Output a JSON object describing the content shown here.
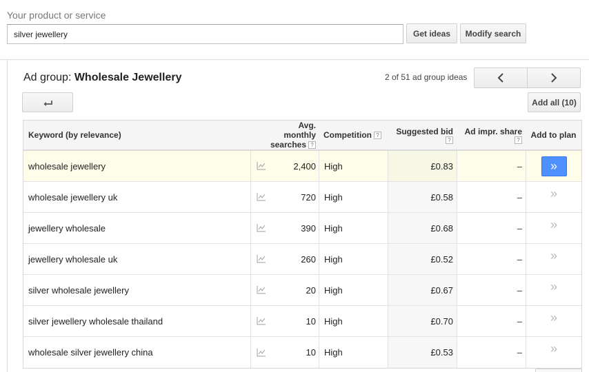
{
  "search": {
    "label": "Your product or service",
    "value": "silver jewellery",
    "get_ideas": "Get ideas",
    "modify_search": "Modify search"
  },
  "adgroup": {
    "prefix": "Ad group: ",
    "name": "Wholesale Jewellery",
    "pager_text": "2 of 51 ad group ideas",
    "add_all": "Add all (10)"
  },
  "table": {
    "headers": {
      "keyword": "Keyword (by relevance)",
      "avg_line1": "Avg. monthly",
      "avg_line2": "searches",
      "competition": "Competition",
      "bid_line1": "Suggested bid",
      "impr": "Ad impr. share",
      "add": "Add to plan",
      "help": "?"
    },
    "rows": [
      {
        "keyword": "wholesale jewellery",
        "searches": "2,400",
        "competition": "High",
        "bid": "£0.83",
        "impr": "–"
      },
      {
        "keyword": "wholesale jewellery uk",
        "searches": "720",
        "competition": "High",
        "bid": "£0.58",
        "impr": "–"
      },
      {
        "keyword": "jewellery wholesale",
        "searches": "390",
        "competition": "High",
        "bid": "£0.68",
        "impr": "–"
      },
      {
        "keyword": "jewellery wholesale uk",
        "searches": "260",
        "competition": "High",
        "bid": "£0.52",
        "impr": "–"
      },
      {
        "keyword": "silver wholesale jewellery",
        "searches": "20",
        "competition": "High",
        "bid": "£0.67",
        "impr": "–"
      },
      {
        "keyword": "silver jewellery wholesale thailand",
        "searches": "10",
        "competition": "High",
        "bid": "£0.70",
        "impr": "–"
      },
      {
        "keyword": "wholesale silver jewellery china",
        "searches": "10",
        "competition": "High",
        "bid": "£0.53",
        "impr": "–"
      }
    ]
  },
  "icons": {
    "add": "»",
    "trend": "trend-chart-icon",
    "back": "back-arrow-icon",
    "prev": "chevron-left-icon",
    "next": "chevron-right-icon"
  },
  "colors": {
    "accent": "#4d90fe",
    "highlight_row": "#fdfde9"
  }
}
